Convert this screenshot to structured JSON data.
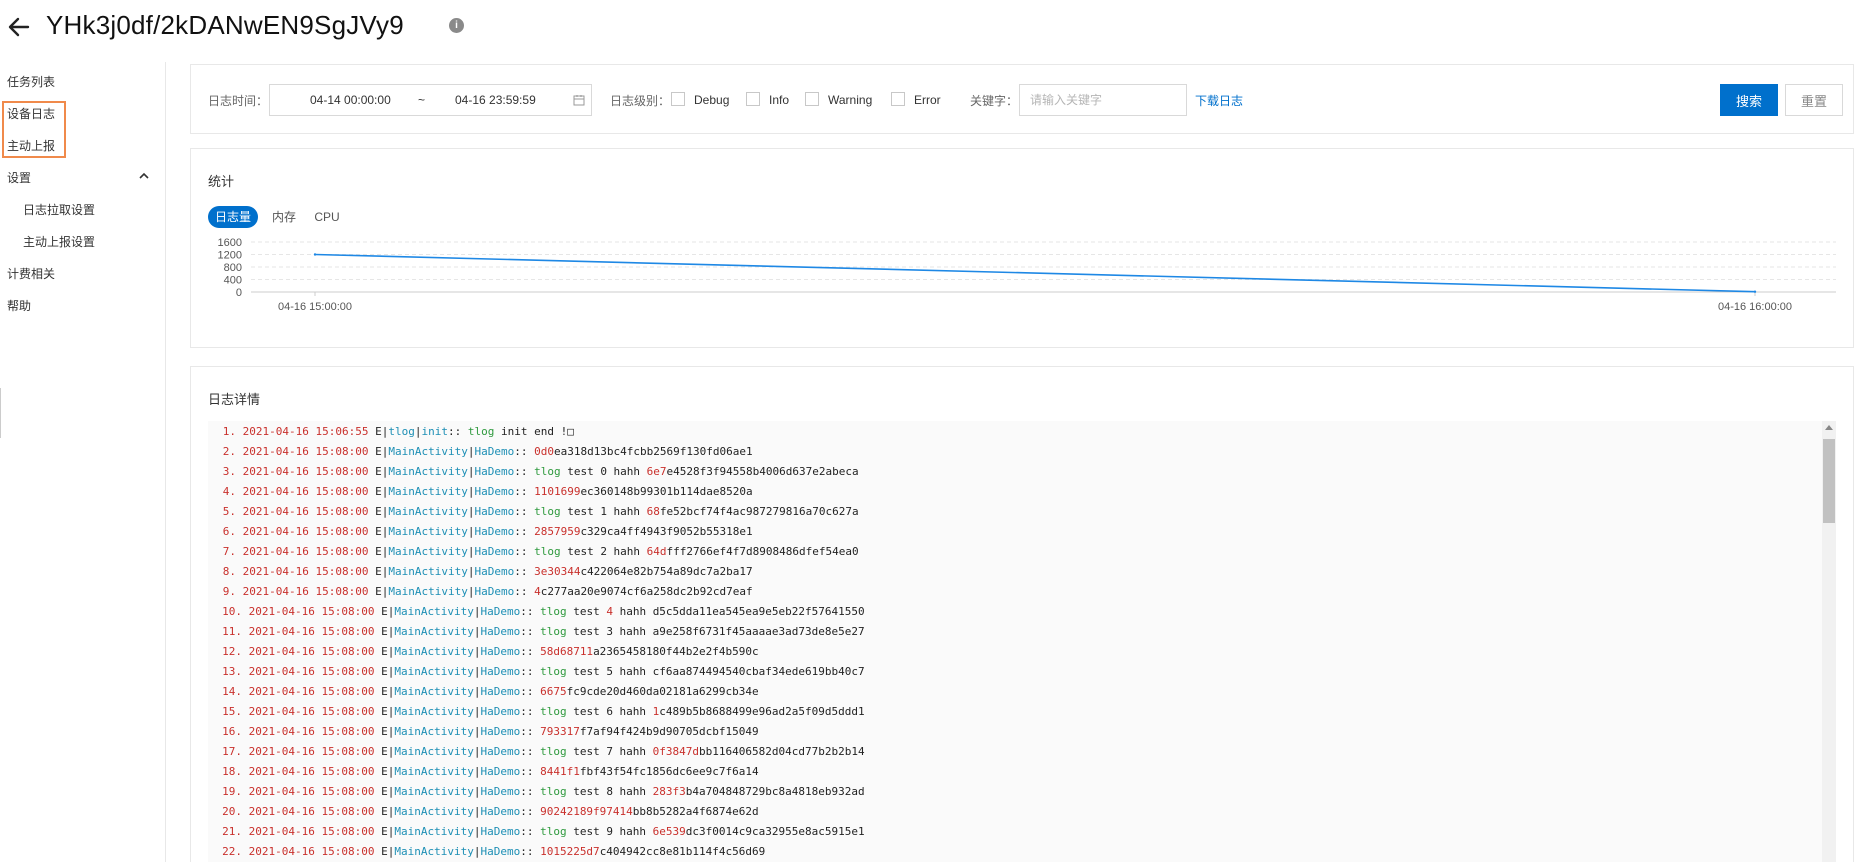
{
  "header": {
    "title": "YHk3j0df/2kDANwEN9SgJVy9",
    "info_icon": "i"
  },
  "sidebar": {
    "items": [
      {
        "label": "任务列表"
      },
      {
        "label": "设备日志"
      },
      {
        "label": "主动上报"
      },
      {
        "label": "设置"
      },
      {
        "label": "日志拉取设置"
      },
      {
        "label": "主动上报设置"
      },
      {
        "label": "计费相关"
      },
      {
        "label": "帮助"
      }
    ]
  },
  "filter": {
    "time_label": "日志时间：",
    "start": "04-14 00:00:00",
    "separator": "~",
    "end": "04-16 23:59:59",
    "level_label": "日志级别：",
    "levels": [
      "Debug",
      "Info",
      "Warning",
      "Error"
    ],
    "keyword_label": "关键字：",
    "keyword_placeholder": "请输入关键字",
    "download": "下载日志",
    "search": "搜索",
    "reset": "重置"
  },
  "stats": {
    "title": "统计",
    "tabs": [
      "日志量",
      "内存",
      "CPU"
    ],
    "active_tab": "日志量"
  },
  "chart_data": {
    "type": "line",
    "x": [
      "04-16 15:00:00",
      "04-16 16:00:00"
    ],
    "series": [
      {
        "values": [
          1200,
          10
        ]
      }
    ],
    "ylim": [
      0,
      1600
    ],
    "yticks": [
      1600,
      1200,
      800,
      400,
      0
    ],
    "grid": true,
    "line_color": "#1e88e5"
  },
  "detail": {
    "title": "日志详情",
    "lines": [
      {
        "n": "1.",
        "ts": "2021-04-16 15:06:55",
        "tag": [
          "tlog",
          "init",
          ""
        ],
        "mt": "plain",
        "p1": "tlog",
        "p2": " init end !",
        "p3": ""
      },
      {
        "n": "2.",
        "ts": "2021-04-16 15:08:00",
        "tag": [
          "MainActivity",
          "HaDemo",
          ""
        ],
        "mt": "hash",
        "p1": "0d0",
        "p2": "ea318d13bc4fcbb2569f130fd06ae1",
        "p3": ""
      },
      {
        "n": "3.",
        "ts": "2021-04-16 15:08:00",
        "tag": [
          "MainActivity",
          "HaDemo",
          ""
        ],
        "mt": "test",
        "p1": "tlog",
        "p2": " test 0 hahh ",
        "p3": "6e7",
        "p4": "e4528f3f94558b4006d637e2abeca"
      },
      {
        "n": "4.",
        "ts": "2021-04-16 15:08:00",
        "tag": [
          "MainActivity",
          "HaDemo",
          ""
        ],
        "mt": "hash",
        "p1": "1101699",
        "p2": "ec360148b99301b114dae8520a",
        "p3": ""
      },
      {
        "n": "5.",
        "ts": "2021-04-16 15:08:00",
        "tag": [
          "MainActivity",
          "HaDemo",
          ""
        ],
        "mt": "test",
        "p1": "tlog",
        "p2": " test 1 hahh ",
        "p3": "68",
        "p4": "fe52bcf74f4ac987279816a70c627a"
      },
      {
        "n": "6.",
        "ts": "2021-04-16 15:08:00",
        "tag": [
          "MainActivity",
          "HaDemo",
          ""
        ],
        "mt": "hash",
        "p1": "2857959",
        "p2": "c329ca4ff4943f9052b55318e1",
        "p3": ""
      },
      {
        "n": "7.",
        "ts": "2021-04-16 15:08:00",
        "tag": [
          "MainActivity",
          "HaDemo",
          ""
        ],
        "mt": "test",
        "p1": "tlog",
        "p2": " test 2 hahh ",
        "p3": "64d",
        "p4": "fff2766ef4f7d8908486dfef54ea0"
      },
      {
        "n": "8.",
        "ts": "2021-04-16 15:08:00",
        "tag": [
          "MainActivity",
          "HaDemo",
          ""
        ],
        "mt": "hash",
        "p1": "3e30344",
        "p2": "c422064e82b754a89dc7a2ba17",
        "p3": ""
      },
      {
        "n": "9.",
        "ts": "2021-04-16 15:08:00",
        "tag": [
          "MainActivity",
          "HaDemo",
          ""
        ],
        "mt": "hash",
        "p1": "4",
        "p2": "c277aa20e9074cf6a258dc2b92cd7eaf",
        "p3": ""
      },
      {
        "n": "10.",
        "ts": "2021-04-16 15:08:00",
        "tag": [
          "MainActivity",
          "HaDemo",
          ""
        ],
        "mt": "test",
        "p1": "tlog",
        "p2": " test ",
        "p3": "4",
        "p4": " hahh d5c5dda11ea545ea9e5eb22f57641550"
      },
      {
        "n": "11.",
        "ts": "2021-04-16 15:08:00",
        "tag": [
          "MainActivity",
          "HaDemo",
          ""
        ],
        "mt": "test",
        "p1": "tlog",
        "p2": " test 3 hahh a9e258f6731f45aaaae3ad73de8e5e27",
        "p3": "",
        "p4": ""
      },
      {
        "n": "12.",
        "ts": "2021-04-16 15:08:00",
        "tag": [
          "MainActivity",
          "HaDemo",
          ""
        ],
        "mt": "hash",
        "p1": "58d68711",
        "p2": "a2365458180f44b2e2f4b590c",
        "p3": ""
      },
      {
        "n": "13.",
        "ts": "2021-04-16 15:08:00",
        "tag": [
          "MainActivity",
          "HaDemo",
          ""
        ],
        "mt": "test",
        "p1": "tlog",
        "p2": " test 5 hahh cf6aa874494540cbaf34ede619bb40c7",
        "p3": "",
        "p4": ""
      },
      {
        "n": "14.",
        "ts": "2021-04-16 15:08:00",
        "tag": [
          "MainActivity",
          "HaDemo",
          ""
        ],
        "mt": "hash",
        "p1": "6675",
        "p2": "fc9cde20d460da02181a6299cb34e",
        "p3": ""
      },
      {
        "n": "15.",
        "ts": "2021-04-16 15:08:00",
        "tag": [
          "MainActivity",
          "HaDemo",
          ""
        ],
        "mt": "test",
        "p1": "tlog",
        "p2": " test 6 hahh ",
        "p3": "1",
        "p4": "c489b5b8688499e96ad2a5f09d5ddd1"
      },
      {
        "n": "16.",
        "ts": "2021-04-16 15:08:00",
        "tag": [
          "MainActivity",
          "HaDemo",
          ""
        ],
        "mt": "hash",
        "p1": "793317",
        "p2": "f7af94f424b9d90705dcbf15049",
        "p3": ""
      },
      {
        "n": "17.",
        "ts": "2021-04-16 15:08:00",
        "tag": [
          "MainActivity",
          "HaDemo",
          ""
        ],
        "mt": "test",
        "p1": "tlog",
        "p2": " test 7 hahh ",
        "p3": "0f3847d",
        "p4": "bb116406582d04cd77b2b2b14"
      },
      {
        "n": "18.",
        "ts": "2021-04-16 15:08:00",
        "tag": [
          "MainActivity",
          "HaDemo",
          ""
        ],
        "mt": "hash",
        "p1": "8441f1",
        "p2": "fbf43f54fc1856dc6ee9c7f6a14",
        "p3": ""
      },
      {
        "n": "19.",
        "ts": "2021-04-16 15:08:00",
        "tag": [
          "MainActivity",
          "HaDemo",
          ""
        ],
        "mt": "test",
        "p1": "tlog",
        "p2": " test 8 hahh ",
        "p3": "283f3",
        "p4": "b4a704848729bc8a4818eb932ad"
      },
      {
        "n": "20.",
        "ts": "2021-04-16 15:08:00",
        "tag": [
          "MainActivity",
          "HaDemo",
          ""
        ],
        "mt": "hash",
        "p1": "90242189f97414",
        "p2": "bb8b5282a4f6874e62d",
        "p3": ""
      },
      {
        "n": "21.",
        "ts": "2021-04-16 15:08:00",
        "tag": [
          "MainActivity",
          "HaDemo",
          ""
        ],
        "mt": "test",
        "p1": "tlog",
        "p2": " test 9 hahh ",
        "p3": "6e539",
        "p4": "dc3f0014c9ca32955e8ac5915e1"
      },
      {
        "n": "22.",
        "ts": "2021-04-16 15:08:00",
        "tag": [
          "MainActivity",
          "HaDemo",
          ""
        ],
        "mt": "hash",
        "p1": "1015225d7",
        "p2": "c404942cc8e81b114f4c56d69",
        "p3": ""
      }
    ]
  }
}
